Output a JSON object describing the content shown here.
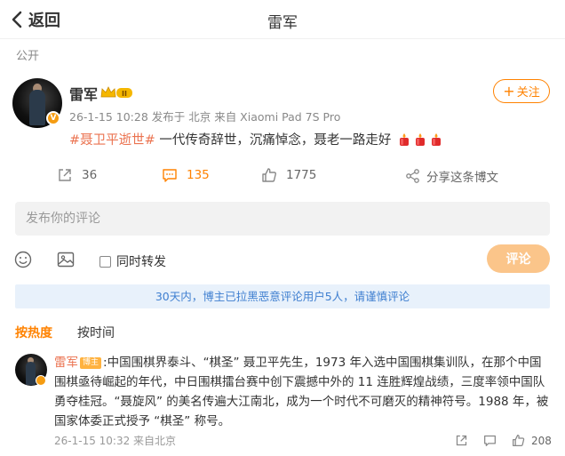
{
  "header": {
    "back_label": "返回",
    "title": "雷军"
  },
  "visibility": "公开",
  "post": {
    "author": "雷军",
    "meta": "26-1-15 10:28 发布于 北京 来自 Xiaomi Pad 7S Pro",
    "follow_label": "关注",
    "hashtag": "#聂卫平逝世#",
    "text": " 一代传奇辞世，沉痛悼念，聂老一路走好",
    "actions": {
      "reposts": "36",
      "comments": "135",
      "likes": "1775",
      "share": "分享这条博文"
    }
  },
  "composer": {
    "placeholder": "发布你的评论",
    "repost_label": "同时转发",
    "submit_label": "评论",
    "notice": "30天内，博主已拉黑恶意评论用户5人，请谨慎评论"
  },
  "sort": {
    "hot": "按热度",
    "time": "按时间"
  },
  "comment": {
    "author": "雷军",
    "badge": "博主",
    "text": ":中国围棋界泰斗、“棋圣” 聂卫平先生，1973 年入选中国围棋集训队，在那个中国围棋亟待崛起的年代，中日围棋擂台赛中创下震撼中外的 11 连胜辉煌战绩，三度率领中国队勇夺桂冠。“聂旋风” 的美名传遍大江南北，成为一个时代不可磨灭的精神符号。1988 年，被国家体委正式授予 “棋圣” 称号。",
    "meta": "26-1-15 10:32 来自北京",
    "likes": "208"
  },
  "colors": {
    "accent": "#ff8200",
    "link": "#eb7350",
    "notice_bg": "#e8f1fb",
    "notice_text": "#3f7fd0"
  },
  "icons": [
    "chevron-left-icon",
    "vip-crown-icon",
    "candle-icon",
    "repost-icon",
    "comment-icon",
    "like-icon",
    "share-icon",
    "emoji-icon",
    "image-icon",
    "checkbox-icon"
  ]
}
